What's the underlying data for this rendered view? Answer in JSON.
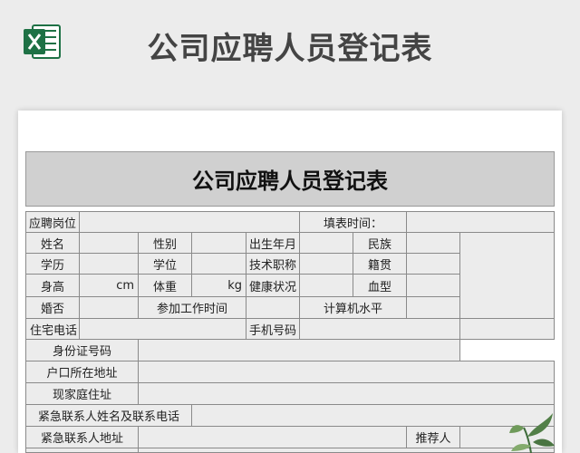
{
  "header": {
    "title": "公司应聘人员登记表",
    "icon": "excel-icon"
  },
  "form": {
    "title": "公司应聘人员登记表",
    "labels": {
      "position": "应聘岗位",
      "fill_time": "填表时间：",
      "name": "姓名",
      "gender": "性别",
      "birth": "出生年月",
      "ethnicity": "民族",
      "education": "学历",
      "degree": "学位",
      "title": "技术职称",
      "origin": "籍贯",
      "height": "身高",
      "height_unit": "cm",
      "weight": "体重",
      "weight_unit": "kg",
      "health": "健康状况",
      "blood": "血型",
      "marital": "婚否",
      "work_start": "参加工作时间",
      "computer": "计算机水平",
      "home_phone": "住宅电话",
      "mobile": "手机号码",
      "id_number": "身份证号码",
      "hukou": "户口所在地址",
      "residence": "现家庭住址",
      "emergency": "紧急联系人姓名及联系电话",
      "emergency_addr": "紧急联系人地址",
      "referrer": "推荐人"
    }
  },
  "colors": {
    "excel_green": "#1e7145",
    "title_band": "#d0d0d0",
    "cell_bg": "#ececec",
    "grid": "#8a8a8a"
  }
}
